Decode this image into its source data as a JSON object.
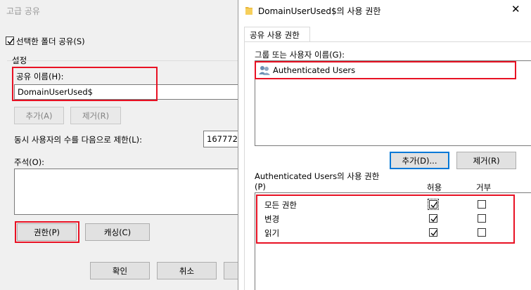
{
  "left_dialog": {
    "title": "고급 공유",
    "share_checkbox_label": "선택한 폴더 공유(S)",
    "share_checked": true,
    "settings_group": "설정",
    "share_name_label": "공유 이름(H):",
    "share_name_value": "DomainUserUsed$",
    "add_label": "추가(A)",
    "remove_label": "제거(R)",
    "limit_label": "동시 사용자의 수를 다음으로 제한(L):",
    "limit_value": "167772",
    "comment_label": "주석(O):",
    "permissions_label": "권한(P)",
    "caching_label": "캐싱(C)",
    "ok_label": "확인",
    "cancel_label": "취소"
  },
  "right_dialog": {
    "title": "DomainUserUsed$의 사용 권한",
    "tab_label": "공유 사용 권한",
    "group_label": "그룹 또는 사용자 이름(G):",
    "users": [
      "Authenticated Users"
    ],
    "add_label": "추가(D)...",
    "remove_label": "제거(R)",
    "perm_header_line1": "Authenticated Users의 사용 권한",
    "perm_header_line2": "(P)",
    "allow_header": "허용",
    "deny_header": "거부",
    "permissions": [
      {
        "name": "모든 권한",
        "allow": true,
        "deny": false
      },
      {
        "name": "변경",
        "allow": true,
        "deny": false
      },
      {
        "name": "읽기",
        "allow": true,
        "deny": false
      }
    ]
  }
}
